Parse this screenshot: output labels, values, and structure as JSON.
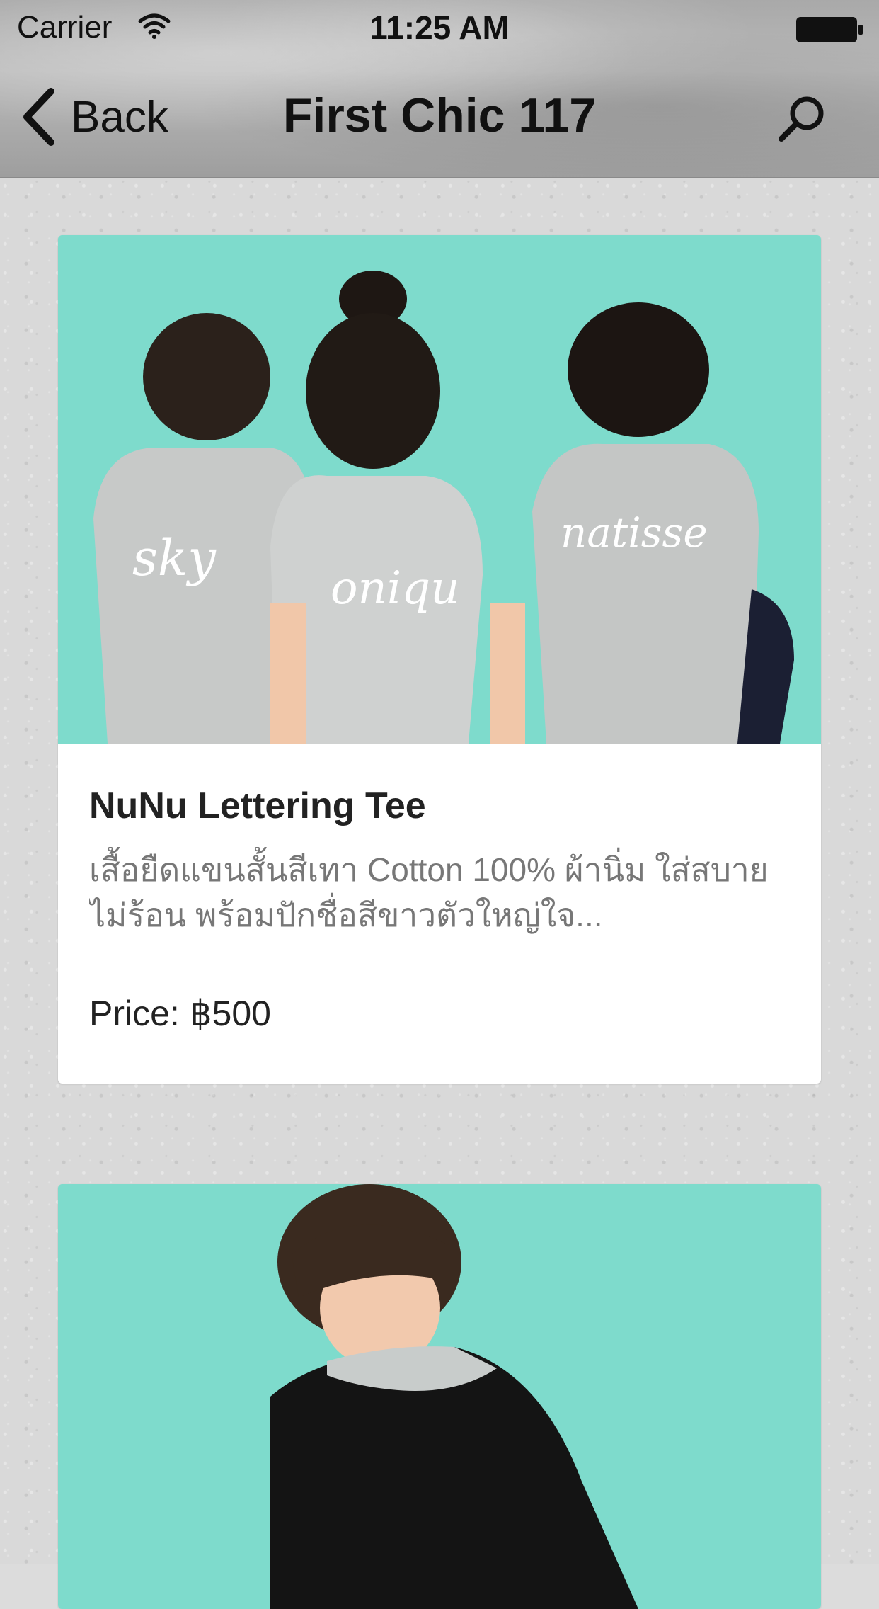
{
  "status_bar": {
    "carrier": "Carrier",
    "time": "11:25 AM",
    "wifi_icon": "wifi-icon",
    "battery_icon": "battery-icon"
  },
  "nav": {
    "back_label": "Back",
    "title": "First Chic 117",
    "back_icon": "chevron-left-icon",
    "search_icon": "search-icon"
  },
  "products": [
    {
      "name": "NuNu Lettering Tee",
      "description": "เสื้อยืดแขนสั้นสีเทา Cotton 100% ผ้านิ่ม ใส่สบาย ไม่ร้อน พร้อมปักชื่อสีขาวตัวใหญ่ใจ...",
      "price": "Price: ฿500",
      "image_alt": "Three children in grey tees seen from behind against a mint background",
      "shirt_texts": [
        "sky",
        "oniqu",
        "natisse"
      ]
    },
    {
      "image_alt": "Boy in a black and grey long-sleeve top against a mint background"
    }
  ],
  "colors": {
    "image_background": "#7edbcc",
    "card_background": "#ffffff",
    "title_text": "#222222",
    "description_text": "#777777"
  }
}
